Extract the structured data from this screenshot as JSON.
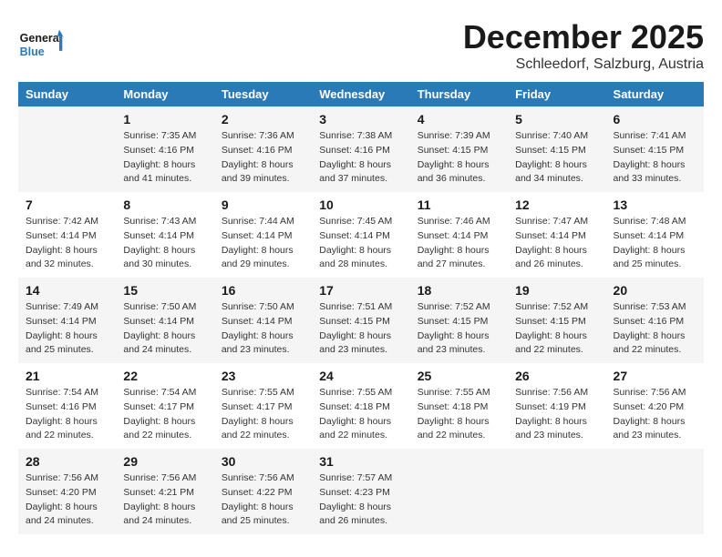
{
  "header": {
    "logo_line1": "General",
    "logo_line2": "Blue",
    "month": "December 2025",
    "location": "Schleedorf, Salzburg, Austria"
  },
  "days_of_week": [
    "Sunday",
    "Monday",
    "Tuesday",
    "Wednesday",
    "Thursday",
    "Friday",
    "Saturday"
  ],
  "weeks": [
    [
      {
        "day": "",
        "info": ""
      },
      {
        "day": "1",
        "info": "Sunrise: 7:35 AM\nSunset: 4:16 PM\nDaylight: 8 hours\nand 41 minutes."
      },
      {
        "day": "2",
        "info": "Sunrise: 7:36 AM\nSunset: 4:16 PM\nDaylight: 8 hours\nand 39 minutes."
      },
      {
        "day": "3",
        "info": "Sunrise: 7:38 AM\nSunset: 4:16 PM\nDaylight: 8 hours\nand 37 minutes."
      },
      {
        "day": "4",
        "info": "Sunrise: 7:39 AM\nSunset: 4:15 PM\nDaylight: 8 hours\nand 36 minutes."
      },
      {
        "day": "5",
        "info": "Sunrise: 7:40 AM\nSunset: 4:15 PM\nDaylight: 8 hours\nand 34 minutes."
      },
      {
        "day": "6",
        "info": "Sunrise: 7:41 AM\nSunset: 4:15 PM\nDaylight: 8 hours\nand 33 minutes."
      }
    ],
    [
      {
        "day": "7",
        "info": "Sunrise: 7:42 AM\nSunset: 4:14 PM\nDaylight: 8 hours\nand 32 minutes."
      },
      {
        "day": "8",
        "info": "Sunrise: 7:43 AM\nSunset: 4:14 PM\nDaylight: 8 hours\nand 30 minutes."
      },
      {
        "day": "9",
        "info": "Sunrise: 7:44 AM\nSunset: 4:14 PM\nDaylight: 8 hours\nand 29 minutes."
      },
      {
        "day": "10",
        "info": "Sunrise: 7:45 AM\nSunset: 4:14 PM\nDaylight: 8 hours\nand 28 minutes."
      },
      {
        "day": "11",
        "info": "Sunrise: 7:46 AM\nSunset: 4:14 PM\nDaylight: 8 hours\nand 27 minutes."
      },
      {
        "day": "12",
        "info": "Sunrise: 7:47 AM\nSunset: 4:14 PM\nDaylight: 8 hours\nand 26 minutes."
      },
      {
        "day": "13",
        "info": "Sunrise: 7:48 AM\nSunset: 4:14 PM\nDaylight: 8 hours\nand 25 minutes."
      }
    ],
    [
      {
        "day": "14",
        "info": "Sunrise: 7:49 AM\nSunset: 4:14 PM\nDaylight: 8 hours\nand 25 minutes."
      },
      {
        "day": "15",
        "info": "Sunrise: 7:50 AM\nSunset: 4:14 PM\nDaylight: 8 hours\nand 24 minutes."
      },
      {
        "day": "16",
        "info": "Sunrise: 7:50 AM\nSunset: 4:14 PM\nDaylight: 8 hours\nand 23 minutes."
      },
      {
        "day": "17",
        "info": "Sunrise: 7:51 AM\nSunset: 4:15 PM\nDaylight: 8 hours\nand 23 minutes."
      },
      {
        "day": "18",
        "info": "Sunrise: 7:52 AM\nSunset: 4:15 PM\nDaylight: 8 hours\nand 23 minutes."
      },
      {
        "day": "19",
        "info": "Sunrise: 7:52 AM\nSunset: 4:15 PM\nDaylight: 8 hours\nand 22 minutes."
      },
      {
        "day": "20",
        "info": "Sunrise: 7:53 AM\nSunset: 4:16 PM\nDaylight: 8 hours\nand 22 minutes."
      }
    ],
    [
      {
        "day": "21",
        "info": "Sunrise: 7:54 AM\nSunset: 4:16 PM\nDaylight: 8 hours\nand 22 minutes."
      },
      {
        "day": "22",
        "info": "Sunrise: 7:54 AM\nSunset: 4:17 PM\nDaylight: 8 hours\nand 22 minutes."
      },
      {
        "day": "23",
        "info": "Sunrise: 7:55 AM\nSunset: 4:17 PM\nDaylight: 8 hours\nand 22 minutes."
      },
      {
        "day": "24",
        "info": "Sunrise: 7:55 AM\nSunset: 4:18 PM\nDaylight: 8 hours\nand 22 minutes."
      },
      {
        "day": "25",
        "info": "Sunrise: 7:55 AM\nSunset: 4:18 PM\nDaylight: 8 hours\nand 22 minutes."
      },
      {
        "day": "26",
        "info": "Sunrise: 7:56 AM\nSunset: 4:19 PM\nDaylight: 8 hours\nand 23 minutes."
      },
      {
        "day": "27",
        "info": "Sunrise: 7:56 AM\nSunset: 4:20 PM\nDaylight: 8 hours\nand 23 minutes."
      }
    ],
    [
      {
        "day": "28",
        "info": "Sunrise: 7:56 AM\nSunset: 4:20 PM\nDaylight: 8 hours\nand 24 minutes."
      },
      {
        "day": "29",
        "info": "Sunrise: 7:56 AM\nSunset: 4:21 PM\nDaylight: 8 hours\nand 24 minutes."
      },
      {
        "day": "30",
        "info": "Sunrise: 7:56 AM\nSunset: 4:22 PM\nDaylight: 8 hours\nand 25 minutes."
      },
      {
        "day": "31",
        "info": "Sunrise: 7:57 AM\nSunset: 4:23 PM\nDaylight: 8 hours\nand 26 minutes."
      },
      {
        "day": "",
        "info": ""
      },
      {
        "day": "",
        "info": ""
      },
      {
        "day": "",
        "info": ""
      }
    ]
  ]
}
